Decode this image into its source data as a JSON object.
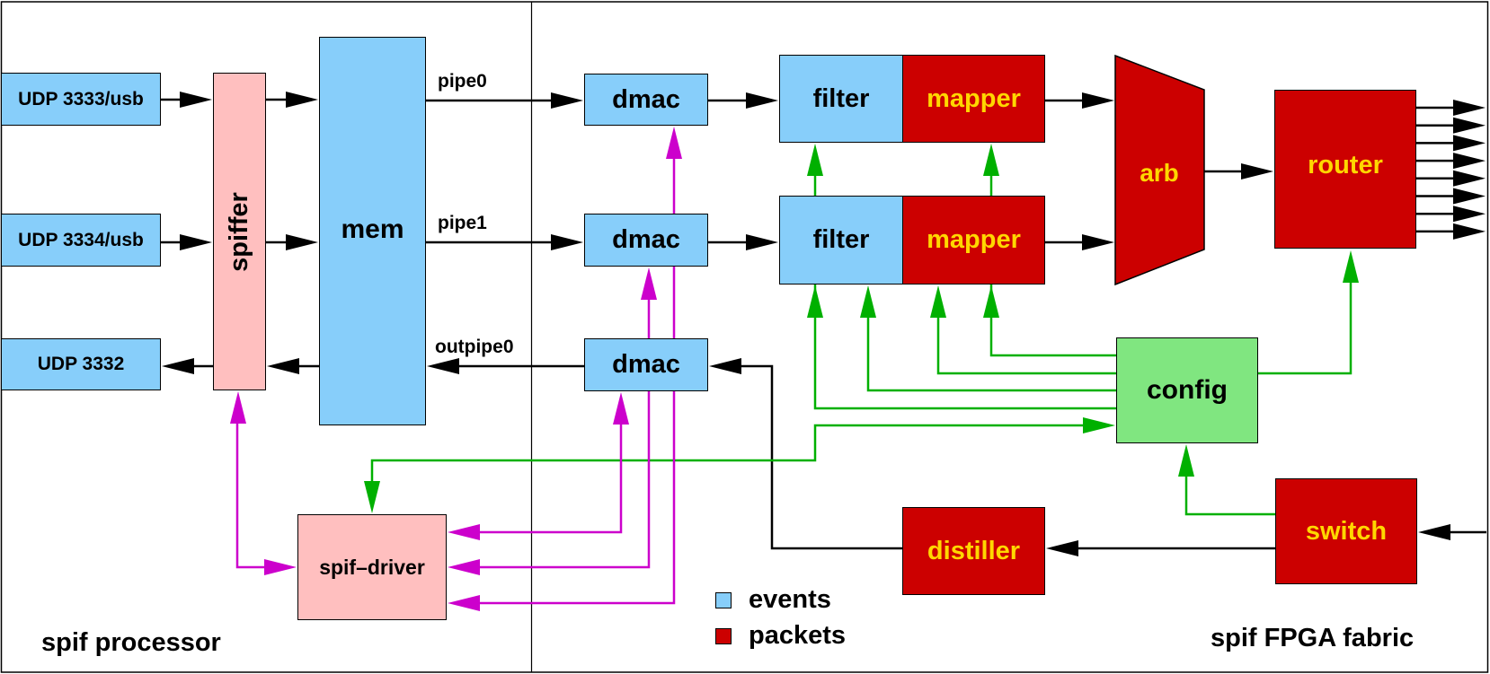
{
  "diagram": {
    "regions": {
      "left": "spif processor",
      "right": "spif FPGA fabric"
    },
    "blocks": {
      "udp3333": "UDP 3333/usb",
      "udp3334": "UDP 3334/usb",
      "udp3332": "UDP 3332",
      "spiffer": "spiffer",
      "mem": "mem",
      "spif_driver": "spif–driver",
      "dmac0": "dmac",
      "dmac1": "dmac",
      "dmac2": "dmac",
      "filter0": "filter",
      "filter1": "filter",
      "mapper0": "mapper",
      "mapper1": "mapper",
      "arb": "arb",
      "router": "router",
      "config": "config",
      "switch": "switch",
      "distiller": "distiller"
    },
    "connection_labels": {
      "pipe0": "pipe0",
      "pipe1": "pipe1",
      "outpipe0": "outpipe0"
    },
    "legend": [
      {
        "label": "events",
        "color": "#87cefa"
      },
      {
        "label": "packets",
        "color": "#cc0000"
      }
    ],
    "colors": {
      "events": "#87cefa",
      "packets": "#cc0000",
      "packet_text": "#ffd700",
      "driver": "#ffbfbf",
      "config": "#80e680",
      "data_flow": "#000000",
      "control_flow": "#00b000",
      "driver_flow": "#cc00cc"
    },
    "router_outputs": 8
  }
}
